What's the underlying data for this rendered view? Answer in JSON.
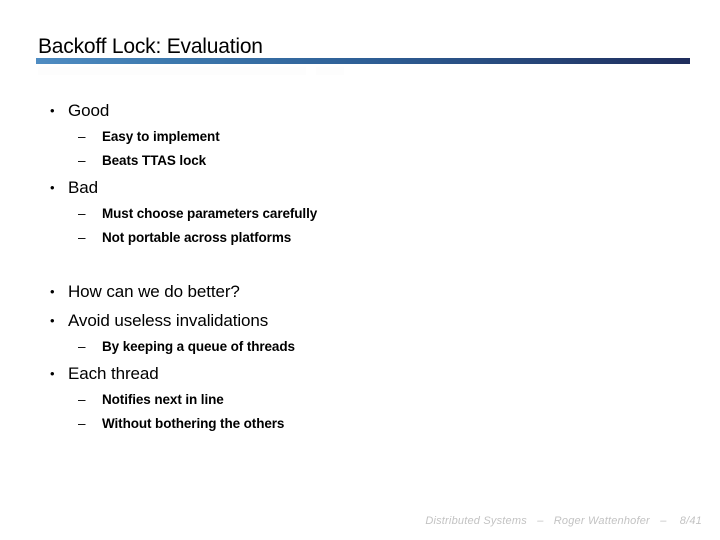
{
  "slide": {
    "title": "Backoff Lock: Evaluation",
    "accent_light": "#4f8cc2",
    "accent_dark": "#1f2d5c",
    "background": "#ffffff",
    "text_color": "#000000"
  },
  "content": {
    "blocks": [
      {
        "level": 1,
        "marker": "•",
        "text": "Good"
      },
      {
        "level": 2,
        "marker": "–",
        "text": "Easy to implement"
      },
      {
        "level": 2,
        "marker": "–",
        "text": "Beats TTAS lock"
      },
      {
        "level": 1,
        "marker": "•",
        "text": "Bad"
      },
      {
        "level": 2,
        "marker": "–",
        "text": "Must choose parameters carefully"
      },
      {
        "level": 2,
        "marker": "–",
        "text": "Not portable across platforms"
      },
      {
        "level": 1,
        "marker": "•",
        "text": "How can we do better?"
      },
      {
        "level": 1,
        "marker": "•",
        "text": "Avoid useless invalidations"
      },
      {
        "level": 2,
        "marker": "–",
        "text": "By keeping a queue of threads"
      },
      {
        "level": 1,
        "marker": "•",
        "text": "Each thread"
      },
      {
        "level": 2,
        "marker": "–",
        "text": "Notifies next in line"
      },
      {
        "level": 2,
        "marker": "–",
        "text": "Without bothering the others"
      }
    ]
  },
  "footer": {
    "course": "Distributed Systems",
    "separator": "–",
    "author": "Roger Wattenhofer",
    "page_separator": "–",
    "page": "8/41",
    "color": "#c3c3c3"
  }
}
